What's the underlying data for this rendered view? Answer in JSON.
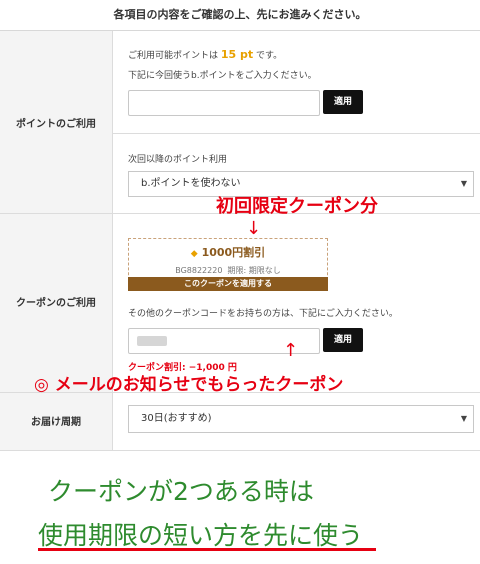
{
  "notice": "各項目の内容をご確認の上、先にお進みください。",
  "points": {
    "label": "ポイントのご利用",
    "available_prefix": "ご利用可能ポイントは",
    "available_value": "15 pt",
    "available_suffix": "です。",
    "instruction": "下記に今回使うb.ポイントをご入力ください。",
    "apply_label": "適用",
    "next_use_label": "次回以降のポイント利用",
    "next_use_value": "b.ポイントを使わない"
  },
  "coupon": {
    "label": "クーポンのご利用",
    "card_title": "1000円割引",
    "card_code": "BG8822220",
    "card_period_label": "期限:",
    "card_period_value": "期限なし",
    "card_apply": "このクーポンを適用する",
    "other_instruction": "その他のクーポンコードをお持ちの方は、下記にご入力ください。",
    "apply_label": "適用",
    "discount_text": "クーポン割引: −1,000 円"
  },
  "delivery": {
    "label": "お届け周期",
    "value": "30日(おすすめ)"
  },
  "annotations": {
    "first_coupon": "初回限定クーポン分",
    "arrow_down": "↓",
    "arrow_up": "↑",
    "mail_coupon": "◎ メールのお知らせでもらったクーポン",
    "tip_line1": "クーポンが2つある時は",
    "tip_line2": "使用期限の短い方を先に使う"
  },
  "colors": {
    "annotation_red": "#e60012",
    "tip_green": "#2e8b2e",
    "points_orange": "#e8a100",
    "coupon_brown": "#8b5a1e"
  }
}
